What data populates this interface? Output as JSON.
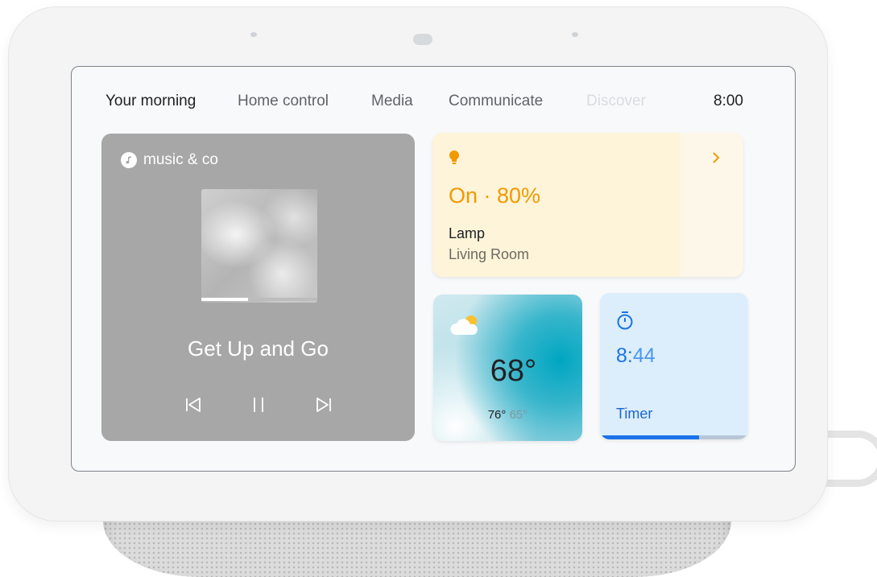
{
  "nav": {
    "tabs": [
      {
        "label": "Your morning",
        "state": "active"
      },
      {
        "label": "Home control",
        "state": "normal"
      },
      {
        "label": "Media",
        "state": "normal"
      },
      {
        "label": "Communicate",
        "state": "normal"
      },
      {
        "label": "Discover",
        "state": "faded"
      }
    ],
    "time": "8:00"
  },
  "music": {
    "source": "music & co",
    "song": "Get Up and Go",
    "progress": 0.4,
    "controls": [
      "previous-icon",
      "pause-icon",
      "next-icon"
    ]
  },
  "lamp": {
    "state": "On · 80%",
    "name": "Lamp",
    "room": "Living Room",
    "icon": "lightbulb-icon",
    "accent": "#f29900"
  },
  "weather": {
    "temp": "68°",
    "high": "76°",
    "low": "65°",
    "icon": "partly-cloudy-icon"
  },
  "timer": {
    "time_hours": "8:",
    "time_minutes": "44",
    "label": "Timer",
    "progress": 0.67,
    "icon": "stopwatch-icon",
    "accent": "#1a73e8"
  }
}
